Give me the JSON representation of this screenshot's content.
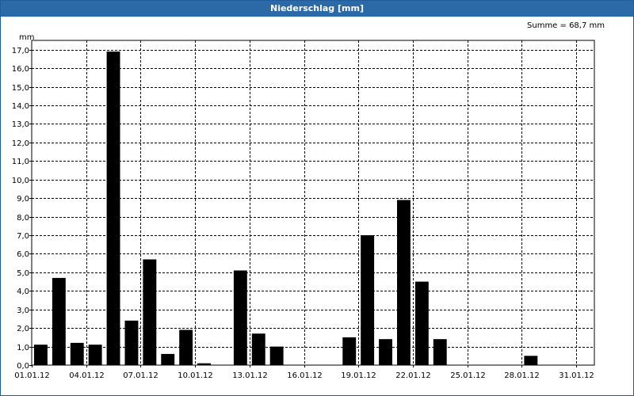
{
  "window": {
    "title": "Niederschlag [mm]"
  },
  "summary": {
    "text": "Summe = 68,7 mm"
  },
  "colors": {
    "titlebar": "#2b6aa6",
    "bar": "#000000",
    "grid": "#000000",
    "background": "#ffffff"
  },
  "chart_data": {
    "type": "bar",
    "title": "Niederschlag [mm]",
    "ylabel": "mm",
    "xlabel": "",
    "ylim": [
      0,
      17.5
    ],
    "grid": true,
    "yticks": [
      "0,0",
      "1,0",
      "2,0",
      "3,0",
      "4,0",
      "5,0",
      "6,0",
      "7,0",
      "8,0",
      "9,0",
      "10,0",
      "11,0",
      "12,0",
      "13,0",
      "14,0",
      "15,0",
      "16,0",
      "17,0"
    ],
    "xticks": [
      "01.01.12",
      "04.01.12",
      "07.01.12",
      "10.01.12",
      "13.01.12",
      "16.01.12",
      "19.01.12",
      "22.01.12",
      "25.01.12",
      "28.01.12",
      "31.01.12"
    ],
    "categories": [
      "01.01.12",
      "02.01.12",
      "03.01.12",
      "04.01.12",
      "05.01.12",
      "06.01.12",
      "07.01.12",
      "08.01.12",
      "09.01.12",
      "10.01.12",
      "11.01.12",
      "12.01.12",
      "13.01.12",
      "14.01.12",
      "15.01.12",
      "16.01.12",
      "17.01.12",
      "18.01.12",
      "19.01.12",
      "20.01.12",
      "21.01.12",
      "22.01.12",
      "23.01.12",
      "24.01.12",
      "25.01.12",
      "26.01.12",
      "27.01.12",
      "28.01.12",
      "29.01.12",
      "30.01.12",
      "31.01.12"
    ],
    "values": [
      1.1,
      4.7,
      1.2,
      1.1,
      16.9,
      2.4,
      5.7,
      0.6,
      1.9,
      0.1,
      0,
      5.1,
      1.7,
      1.0,
      0,
      0,
      0,
      1.5,
      7.0,
      1.4,
      8.9,
      4.5,
      1.4,
      0,
      0,
      0,
      0,
      0.5,
      0,
      0,
      0
    ]
  }
}
